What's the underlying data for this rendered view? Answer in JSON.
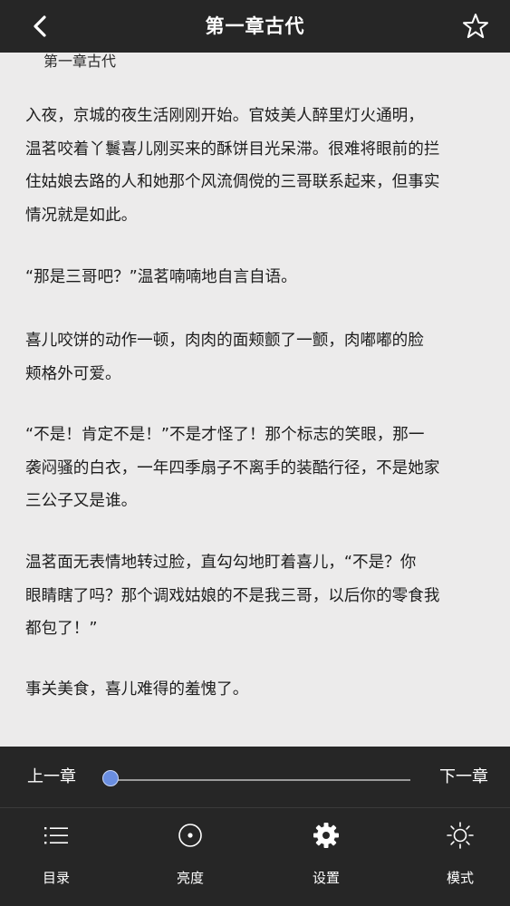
{
  "header": {
    "title": "第一章古代"
  },
  "content": {
    "chapter_heading": "第一章古代",
    "paragraphs": [
      "  入夜，京城的夜生活刚刚开始。官妓美人醉里灯火通明，\n温茗咬着丫鬟喜儿刚买来的酥饼目光呆滞。很难将眼前的拦\n住姑娘去路的人和她那个风流倜傥的三哥联系起来，但事实\n情况就是如此。",
      " “那是三哥吧？”温茗喃喃地自言自语。",
      "  喜儿咬饼的动作一顿，肉肉的面颊颤了一颤，肉嘟嘟的脸\n颊格外可爱。",
      " “不是！肯定不是！”不是才怪了！那个标志的笑眼，那一\n袭闷骚的白衣，一年四季扇子不离手的装酷行径，不是她家\n三公子又是谁。",
      "   温茗面无表情地转过脸，直勾勾地盯着喜儿，“不是？你\n眼睛瞎了吗？那个调戏姑娘的不是我三哥，以后你的零食我\n都包了！”",
      "  事关美食，喜儿难得的羞愧了。"
    ]
  },
  "progress": {
    "prev_label": "上一章",
    "next_label": "下一章",
    "value": 0.0
  },
  "toolbar": {
    "items": [
      {
        "label": "目录",
        "icon": "list-icon"
      },
      {
        "label": "亮度",
        "icon": "brightness-icon"
      },
      {
        "label": "设置",
        "icon": "gear-icon"
      },
      {
        "label": "模式",
        "icon": "sun-icon"
      }
    ]
  },
  "colors": {
    "bar_background": "#262626",
    "page_background": "#ecebeb",
    "slider_thumb": "#6a8ee0"
  }
}
